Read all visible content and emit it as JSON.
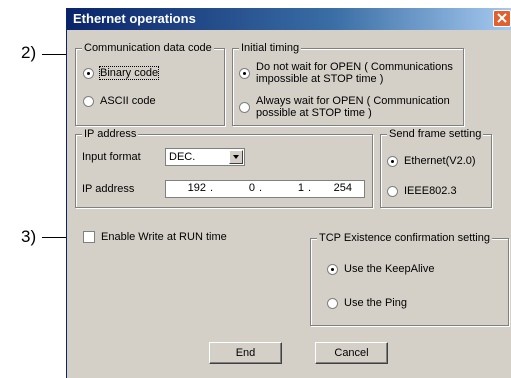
{
  "annotations": {
    "two": "2)",
    "three": "3)"
  },
  "window": {
    "title": "Ethernet operations"
  },
  "comm_code": {
    "legend": "Communication data code",
    "options": [
      "Binary code",
      "ASCII code"
    ],
    "selected": "Binary code"
  },
  "initial_timing": {
    "legend": "Initial timing",
    "options": [
      "Do not wait for OPEN ( Communications\nimpossible at STOP time )",
      "Always wait for OPEN ( Communication\npossible at STOP time )"
    ],
    "selected": 0
  },
  "ip": {
    "legend": "IP address",
    "input_format_label": "Input format",
    "input_format_value": "DEC.",
    "address_label": "IP address",
    "octets": [
      "192",
      "0",
      "1",
      "254"
    ]
  },
  "send_frame": {
    "legend": "Send frame setting",
    "options": [
      "Ethernet(V2.0)",
      "IEEE802.3"
    ],
    "selected": 0
  },
  "write_run": {
    "label": "Enable Write at RUN time",
    "checked": false
  },
  "tcp": {
    "legend": "TCP Existence confirmation setting",
    "options": [
      "Use the KeepAlive",
      "Use the Ping"
    ],
    "selected": 0
  },
  "buttons": {
    "end": "End",
    "cancel": "Cancel"
  }
}
